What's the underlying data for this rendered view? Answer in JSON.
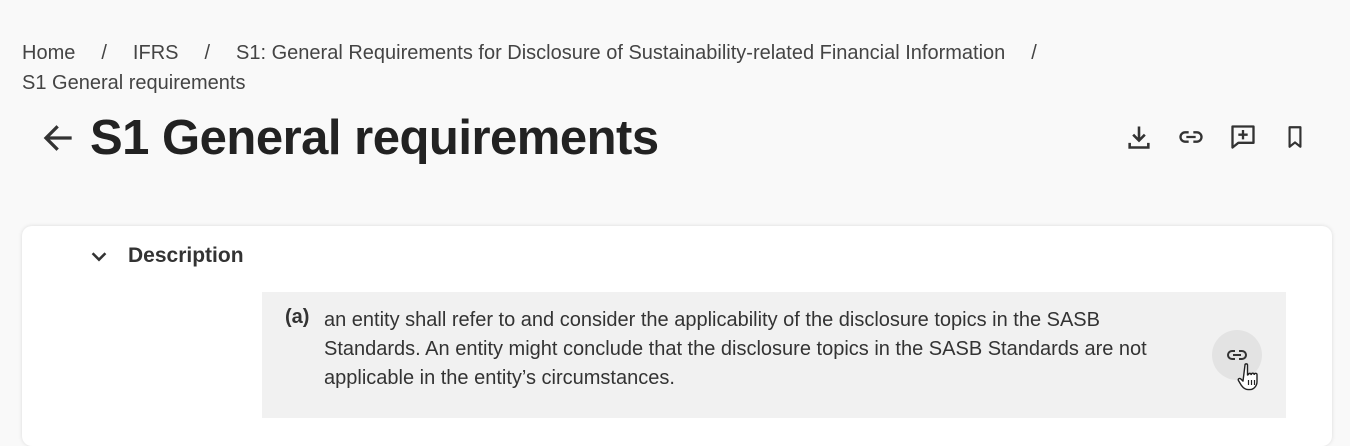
{
  "breadcrumb": {
    "items": [
      "Home",
      "IFRS",
      "S1: General Requirements for Disclosure of Sustainability-related Financial Information"
    ],
    "separator": "/",
    "current": "S1 General requirements"
  },
  "page": {
    "title": "S1 General requirements"
  },
  "actions": {
    "icons": [
      "download-icon",
      "link-icon",
      "add-comment-icon",
      "bookmark-icon"
    ]
  },
  "description": {
    "title": "Description",
    "expanded": true,
    "clause": {
      "label": "(a)",
      "text": "an entity shall refer to and consider the applicability of the disclosure topics in the SASB Standards. An entity might conclude that the disclosure topics in the SASB Standards are not applicable in the entity’s circumstances."
    }
  },
  "colors": {
    "background": "#f9f9f9",
    "card": "#ffffff",
    "clause_background": "#f1f1f1",
    "text": "#333333"
  }
}
